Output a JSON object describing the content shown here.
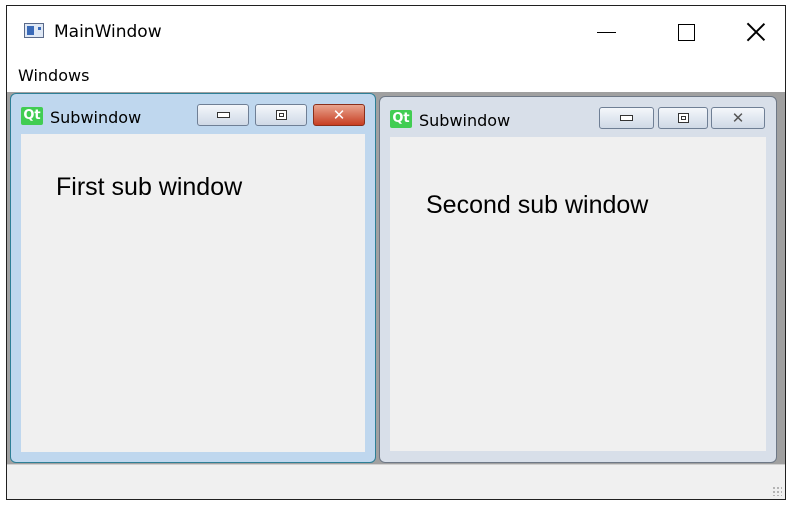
{
  "window": {
    "title": "MainWindow",
    "icon": "app-window-icon",
    "controls": [
      "minimize-icon",
      "maximize-icon",
      "close-icon"
    ]
  },
  "menubar": {
    "items": [
      {
        "label": "Windows"
      }
    ]
  },
  "subwindows": [
    {
      "title": "Subwindow",
      "logo": "Qt",
      "content_text": "First sub window",
      "active": true
    },
    {
      "title": "Subwindow",
      "logo": "Qt",
      "content_text": "Second sub window",
      "active": false
    }
  ],
  "colors": {
    "mdi_background": "#a0a0a0",
    "active_frame": "#bfd7ee",
    "inactive_frame": "#d8dfe9",
    "qt_green": "#41cd52",
    "close_red": "#c73e22"
  }
}
